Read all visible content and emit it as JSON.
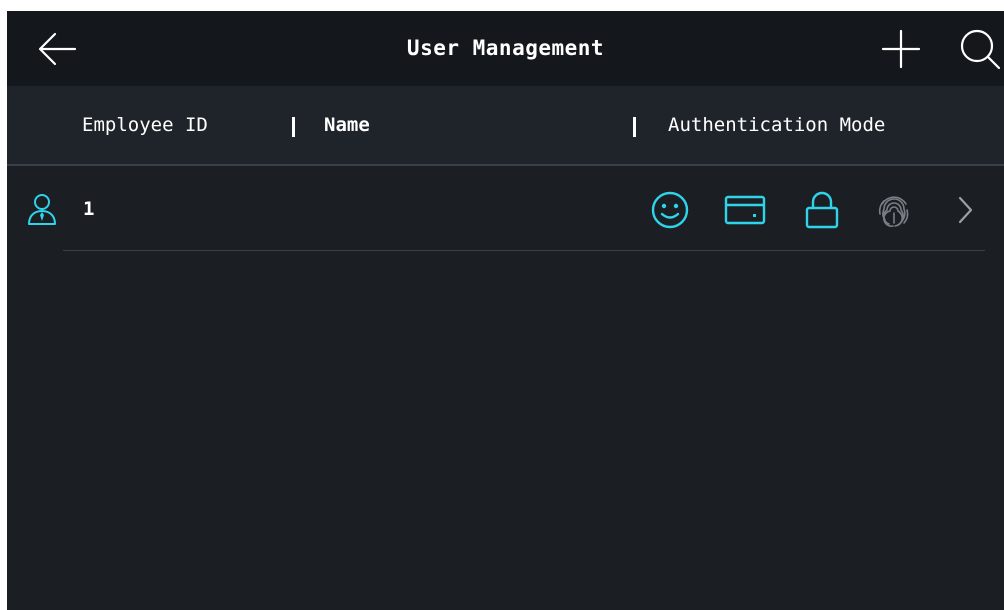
{
  "topbar": {
    "title": "User Management",
    "back_icon": "arrow-left-icon",
    "add_icon": "plus-icon",
    "search_icon": "search-icon"
  },
  "table": {
    "columns": [
      "Employee ID",
      "Name",
      "Authentication Mode"
    ],
    "rows": [
      {
        "employee_id": "1",
        "name": "",
        "auth_modes": [
          "face-icon",
          "card-icon",
          "lock-icon",
          "fingerprint-icon"
        ]
      }
    ]
  },
  "colors": {
    "background": "#1b1f24",
    "topbar": "#14181d",
    "accent": "#2fd4ea",
    "inactive_icon": "#7a7f86",
    "text": "#ffffff"
  }
}
